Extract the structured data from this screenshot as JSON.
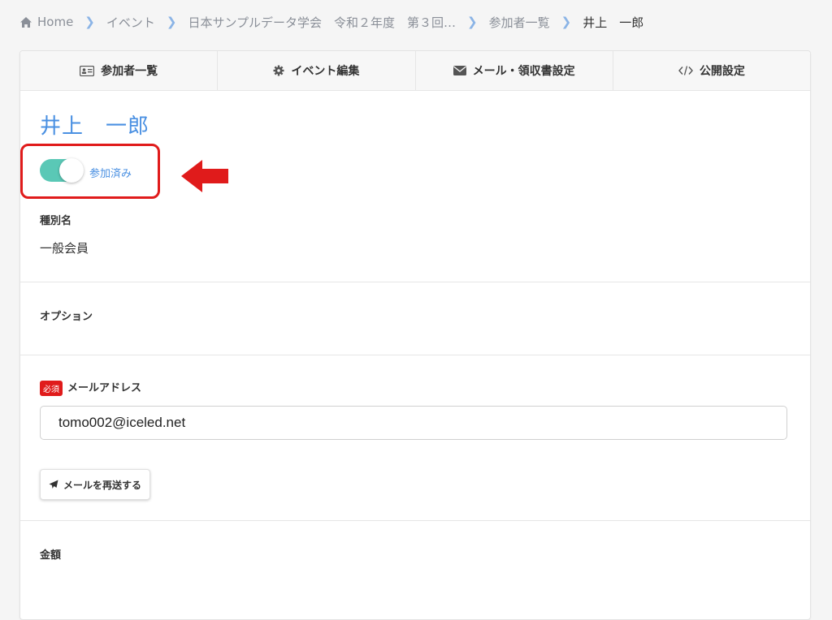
{
  "breadcrumb": {
    "items": [
      "Home",
      "イベント",
      "日本サンプルデータ学会　令和２年度　第３回…",
      "参加者一覧",
      "井上　一郎"
    ]
  },
  "tabs": [
    {
      "label": "参加者一覧",
      "icon": "id-card-icon"
    },
    {
      "label": "イベント編集",
      "icon": "gear-icon"
    },
    {
      "label": "メール・領収書設定",
      "icon": "envelope-icon"
    },
    {
      "label": "公開設定",
      "icon": "code-icon"
    }
  ],
  "participant": {
    "name": "井上　一郎",
    "attendance_label": "参加済み",
    "attendance_on": true
  },
  "type_section": {
    "label": "種別名",
    "value": "一般会員"
  },
  "option_section": {
    "label": "オプション"
  },
  "email_section": {
    "required_badge": "必須",
    "label": "メールアドレス",
    "value": "tomo002@iceled.net"
  },
  "resend_button": {
    "label": "メールを再送する"
  },
  "amount_section": {
    "label": "金額"
  },
  "colors": {
    "accent": "#4a90e2",
    "toggle": "#5ac8b6",
    "highlight": "#e01b1b"
  }
}
